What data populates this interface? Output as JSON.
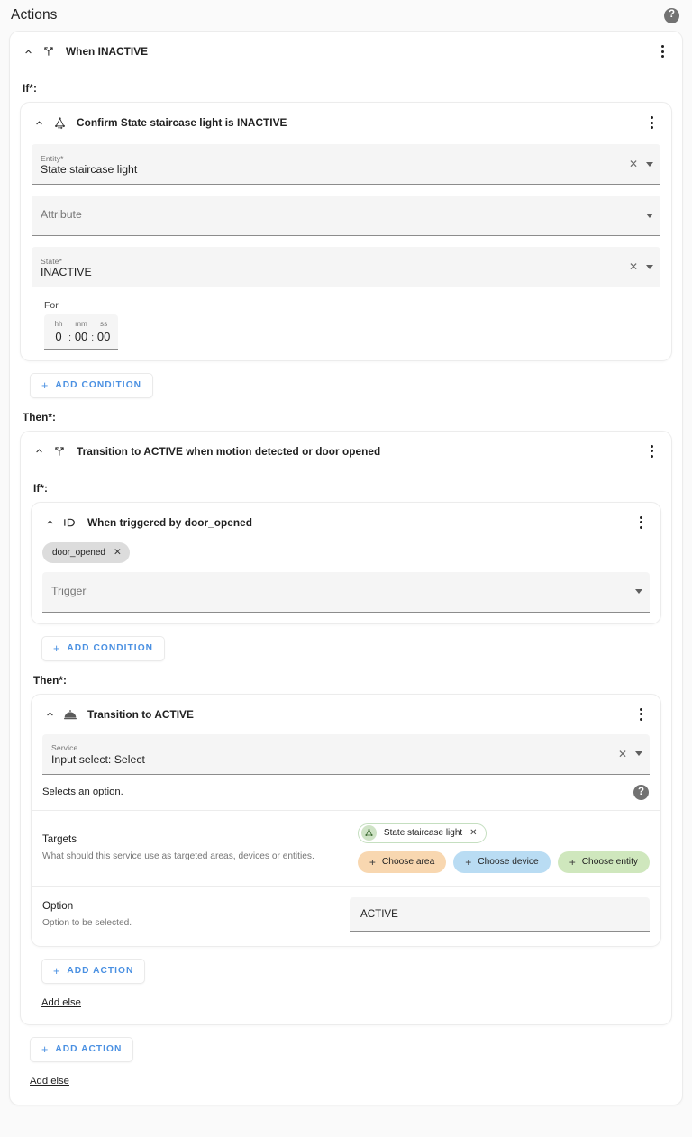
{
  "page": {
    "title": "Actions",
    "help_icon": "help-circle-icon"
  },
  "outer_block": {
    "header": {
      "icon": "call-split-icon",
      "title": "When INACTIVE",
      "collapse_icon": "chevron-up-icon",
      "menu_icon": "overflow-menu-icon"
    },
    "if_label": "If*:",
    "then_label": "Then*:",
    "condition_card": {
      "header": {
        "icon": "state-condition-icon",
        "title": "Confirm State staircase light is INACTIVE",
        "collapse_icon": "chevron-up-icon",
        "menu_icon": "overflow-menu-icon"
      },
      "entity_field": {
        "label": "Entity*",
        "value": "State staircase light",
        "clear_icon": "close-icon",
        "dropdown_icon": "caret-down-icon"
      },
      "attribute_field": {
        "label": "",
        "placeholder": "Attribute",
        "dropdown_icon": "caret-down-icon"
      },
      "state_field": {
        "label": "State*",
        "value": "INACTIVE",
        "clear_icon": "close-icon",
        "dropdown_icon": "caret-down-icon"
      },
      "duration": {
        "label": "For",
        "hh_cap": "hh",
        "hh_val": "0",
        "mm_cap": "mm",
        "mm_val": "00",
        "ss_cap": "ss",
        "ss_val": "00",
        "sep": ":"
      }
    },
    "add_condition_label": "ADD CONDITION",
    "add_action_label": "ADD ACTION",
    "add_else_label": "Add else"
  },
  "nested_block": {
    "header": {
      "icon": "call-split-icon",
      "title": "Transition to ACTIVE when motion detected or door opened",
      "collapse_icon": "chevron-up-icon",
      "menu_icon": "overflow-menu-icon"
    },
    "if_label": "If*:",
    "then_label": "Then*:",
    "trigger_card": {
      "header": {
        "icon": "id-icon",
        "title": "When triggered by door_opened",
        "collapse_icon": "chevron-up-icon",
        "menu_icon": "overflow-menu-icon"
      },
      "chip": {
        "label": "door_opened",
        "remove_icon": "close-icon"
      },
      "trigger_field": {
        "placeholder": "Trigger",
        "dropdown_icon": "caret-down-icon"
      }
    },
    "add_condition_label": "ADD CONDITION",
    "action_card": {
      "header": {
        "icon": "service-dome-icon",
        "title": "Transition to ACTIVE",
        "collapse_icon": "chevron-up-icon",
        "menu_icon": "overflow-menu-icon"
      },
      "service_field": {
        "label": "Service",
        "value": "Input select: Select",
        "clear_icon": "close-icon",
        "dropdown_icon": "caret-down-icon"
      },
      "service_description": "Selects an option.",
      "service_help_icon": "help-circle-icon",
      "targets": {
        "title": "Targets",
        "description": "What should this service use as targeted areas, devices or entities.",
        "entity_chip": {
          "label": "State staircase light",
          "avatar_icon": "state-entity-icon",
          "remove_icon": "close-icon"
        },
        "pickers": [
          {
            "label": "Choose area",
            "icon": "plus-icon",
            "color": "#f8d7b0"
          },
          {
            "label": "Choose device",
            "icon": "plus-icon",
            "color": "#b9dcf3"
          },
          {
            "label": "Choose entity",
            "icon": "plus-icon",
            "color": "#cfe7bd"
          }
        ]
      },
      "option": {
        "title": "Option",
        "description": "Option to be selected.",
        "value": "ACTIVE"
      }
    },
    "add_action_label": "ADD ACTION",
    "add_else_label": "Add else"
  },
  "colors": {
    "accent_blue": "#4a90e2",
    "page_bg": "#fafafa",
    "card_bg": "#ffffff",
    "field_bg": "#f5f5f5",
    "chip_gray": "#dcdcdc"
  }
}
